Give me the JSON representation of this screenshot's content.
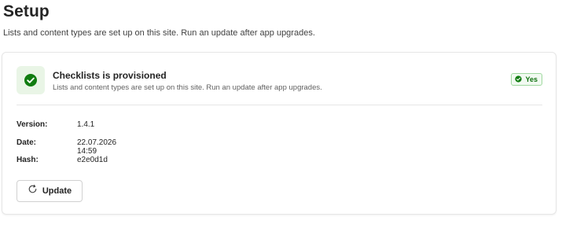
{
  "page": {
    "title": "Setup",
    "subtitle": "Lists and content types are set up on this site. Run an update after app upgrades."
  },
  "status": {
    "title": "Checklists is provisioned",
    "description": "Lists and content types are set up on this site. Run an update after app upgrades.",
    "icon": "checkmark-circle-icon",
    "badge_label": "Yes",
    "badge_icon": "checkmark-circle-icon",
    "colors": {
      "tile_bg": "#e9f5e6",
      "check_fill": "#107c10",
      "badge_border": "#9fd89f",
      "badge_bg": "#f1faf1",
      "badge_text": "#0e700e"
    }
  },
  "details": {
    "version_label": "Version:",
    "version_value": "1.4.1",
    "date_label": "Date:",
    "date_value": "22.07.2026 14:59",
    "hash_label": "Hash:",
    "hash_value": "e2e0d1d"
  },
  "actions": {
    "update_label": "Update",
    "update_icon": "refresh-icon"
  }
}
